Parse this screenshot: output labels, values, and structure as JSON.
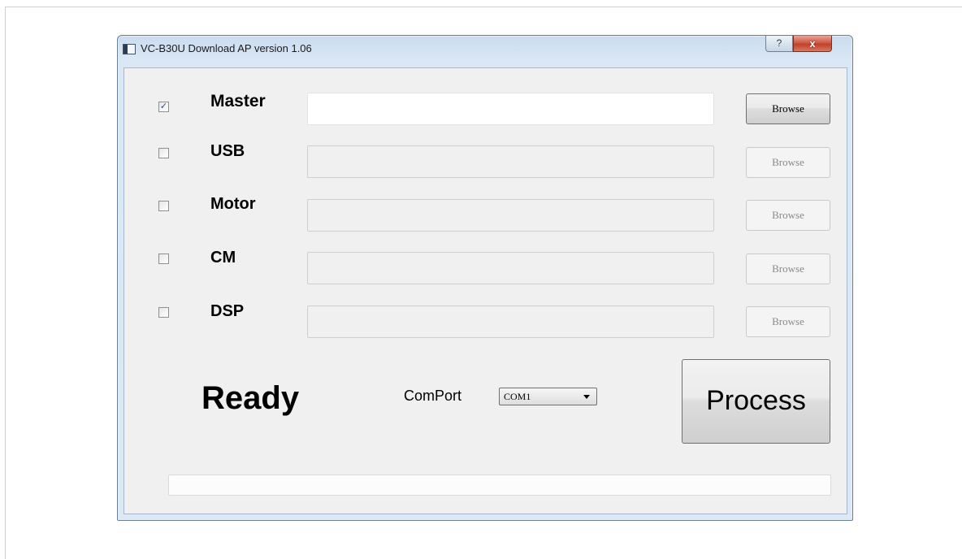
{
  "window": {
    "title": "VC-B30U Download AP version 1.06",
    "help_label": "?",
    "close_label": "x"
  },
  "rows": [
    {
      "label": "Master",
      "checked": true,
      "enabled": true,
      "path_value": "",
      "browse_label": "Browse"
    },
    {
      "label": "USB",
      "checked": false,
      "enabled": false,
      "path_value": "",
      "browse_label": "Browse"
    },
    {
      "label": "Motor",
      "checked": false,
      "enabled": false,
      "path_value": "",
      "browse_label": "Browse"
    },
    {
      "label": "CM",
      "checked": false,
      "enabled": false,
      "path_value": "",
      "browse_label": "Browse"
    },
    {
      "label": "DSP",
      "checked": false,
      "enabled": false,
      "path_value": "",
      "browse_label": "Browse"
    }
  ],
  "status": {
    "text": "Ready"
  },
  "comport": {
    "label": "ComPort",
    "selected": "COM1"
  },
  "process": {
    "label": "Process"
  },
  "progress": {
    "value": 0
  },
  "colors": {
    "progress_fill": "#06b025",
    "close_button": "#c1412c",
    "titlebar": "#c9dcef"
  }
}
